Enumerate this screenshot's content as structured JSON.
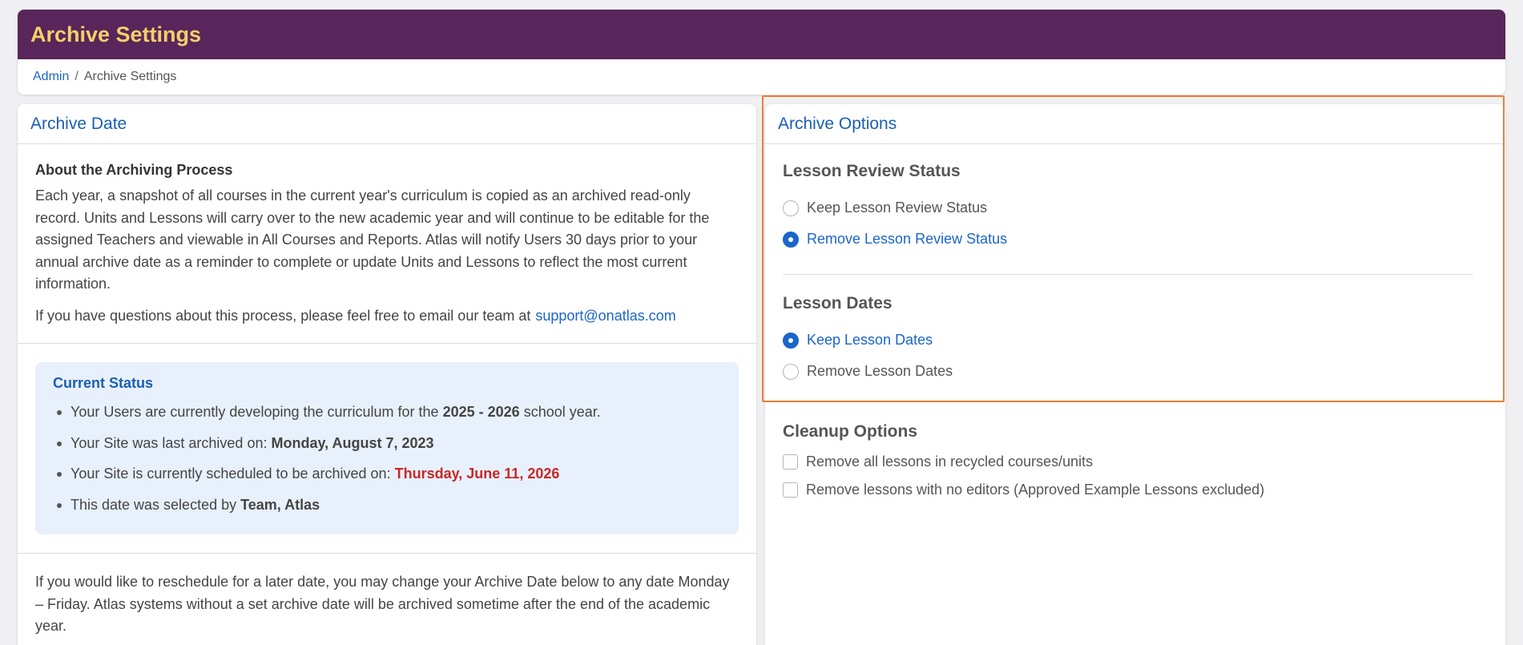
{
  "header": {
    "title": "Archive Settings",
    "breadcrumb": {
      "parent": "Admin",
      "separator": "/",
      "current": "Archive Settings"
    }
  },
  "archive_date": {
    "title": "Archive Date",
    "about_heading": "About the Archiving Process",
    "about_text": "Each year, a snapshot of all courses in the current year's curriculum is copied as an archived read-only record. Units and Lessons will carry over to the new academic year and will continue to be editable for the assigned Teachers and viewable in All Courses and Reports. Atlas will notify Users 30 days prior to your annual archive date as a reminder to complete or update Units and Lessons to reflect the most current information.",
    "questions_text": "If you have questions about this process, please feel free to email our team at",
    "email": "support@onatlas.com",
    "status": {
      "title": "Current Status",
      "items": [
        {
          "prefix": "Your Users are currently developing the curriculum for the",
          "value": "2025 - 2026",
          "suffix": "school year."
        },
        {
          "prefix": "Your Site was last archived on:",
          "value": "Monday, August 7, 2023"
        },
        {
          "prefix": "Your Site is currently scheduled to be archived on:",
          "value": "Thursday, June 11, 2026"
        },
        {
          "prefix": "This date was selected by",
          "value": "Team, Atlas"
        }
      ]
    },
    "reschedule_text": "If you would like to reschedule for a later date, you may change your Archive Date below to any date Monday – Friday. Atlas systems without a set archive date will be archived sometime after the end of the academic year."
  },
  "archive_options": {
    "title": "Archive Options",
    "lesson_review": {
      "heading": "Lesson Review Status",
      "options": [
        "Keep Lesson Review Status",
        "Remove Lesson Review Status"
      ],
      "selected": "Remove Lesson Review Status"
    },
    "lesson_dates": {
      "heading": "Lesson Dates",
      "options": [
        "Keep Lesson Dates",
        "Remove Lesson Dates"
      ],
      "selected": "Keep Lesson Dates"
    },
    "cleanup": {
      "heading": "Cleanup Options",
      "options": [
        "Remove all lessons in recycled courses/units",
        "Remove lessons with no editors (Approved Example Lessons excluded)"
      ]
    }
  },
  "colors": {
    "header_bg": "#58265a",
    "title_color": "#f5cf6b",
    "accent": "#1a66c9",
    "highlight": "#ef7d33",
    "alert": "#c62828"
  }
}
